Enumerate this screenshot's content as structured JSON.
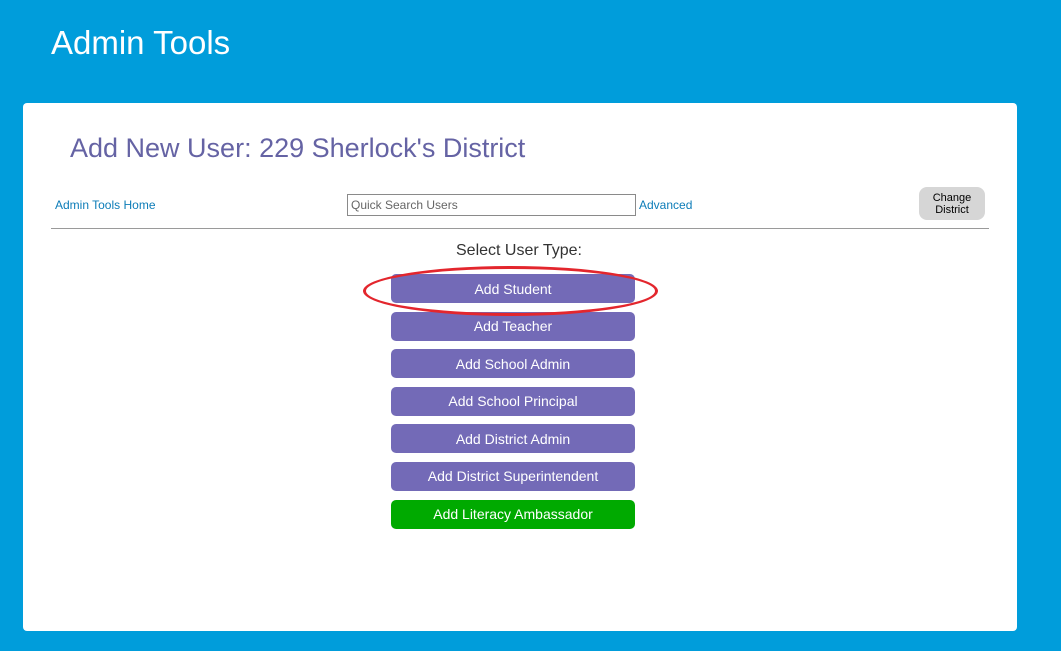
{
  "header": {
    "title": "Admin Tools"
  },
  "page": {
    "title": "Add New User: 229 Sherlock's District"
  },
  "toolbar": {
    "home_link": "Admin Tools Home",
    "search_placeholder": "Quick Search Users",
    "advanced_link": "Advanced",
    "change_district_label": "Change\nDistrict"
  },
  "user_types": {
    "label": "Select User Type:",
    "buttons": [
      "Add Student",
      "Add Teacher",
      "Add School Admin",
      "Add School Principal",
      "Add District Admin",
      "Add District Superintendent",
      "Add Literacy Ambassador"
    ]
  },
  "colors": {
    "background": "#009ddb",
    "button_purple": "#736ab7",
    "button_green": "#00aa00",
    "title": "#6563a4",
    "link": "#0c7cb8",
    "highlight": "#e3262d"
  }
}
